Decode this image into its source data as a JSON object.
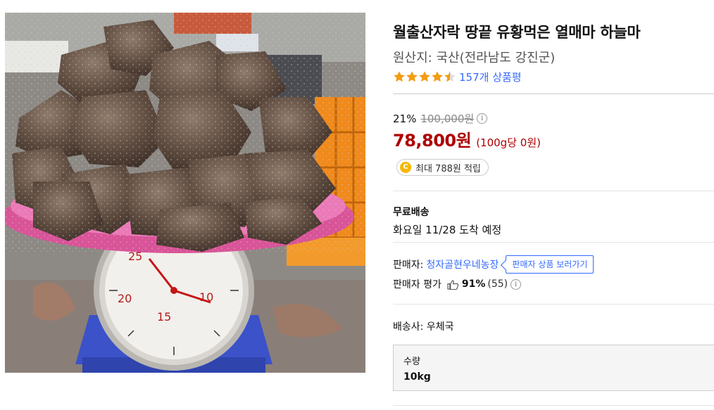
{
  "product": {
    "title": "월출산자락 땅끝 유황먹은 열매마 하늘마",
    "origin": "원산지: 국산(전라남도 강진군)",
    "rating_value": 4.5,
    "review_link": "157개 상품평"
  },
  "pricing": {
    "discount_rate": "21%",
    "original_price": "100,000원",
    "info_icon": "info-icon",
    "sale_price": "78,800원",
    "unit_price": "(100g당 0원)"
  },
  "cashback": {
    "coin_letter": "C",
    "label": "최대 788원 적립"
  },
  "shipping": {
    "title": "무료배송",
    "date": "화요일 11/28 도착 예정"
  },
  "seller": {
    "label": "판매자:",
    "name": "청자골현우네농장",
    "button_label": "판매자 상품 보러가기",
    "eval_label": "판매자 평가",
    "eval_percent": "91%",
    "eval_count": "(55)"
  },
  "courier": "배송사: 우체국",
  "option": {
    "label": "수량",
    "value": "10kg"
  },
  "colors": {
    "accent_blue": "#346aff",
    "price_red": "#ae0000",
    "star_orange": "#f39c12",
    "coin_yellow": "#f5b800"
  }
}
